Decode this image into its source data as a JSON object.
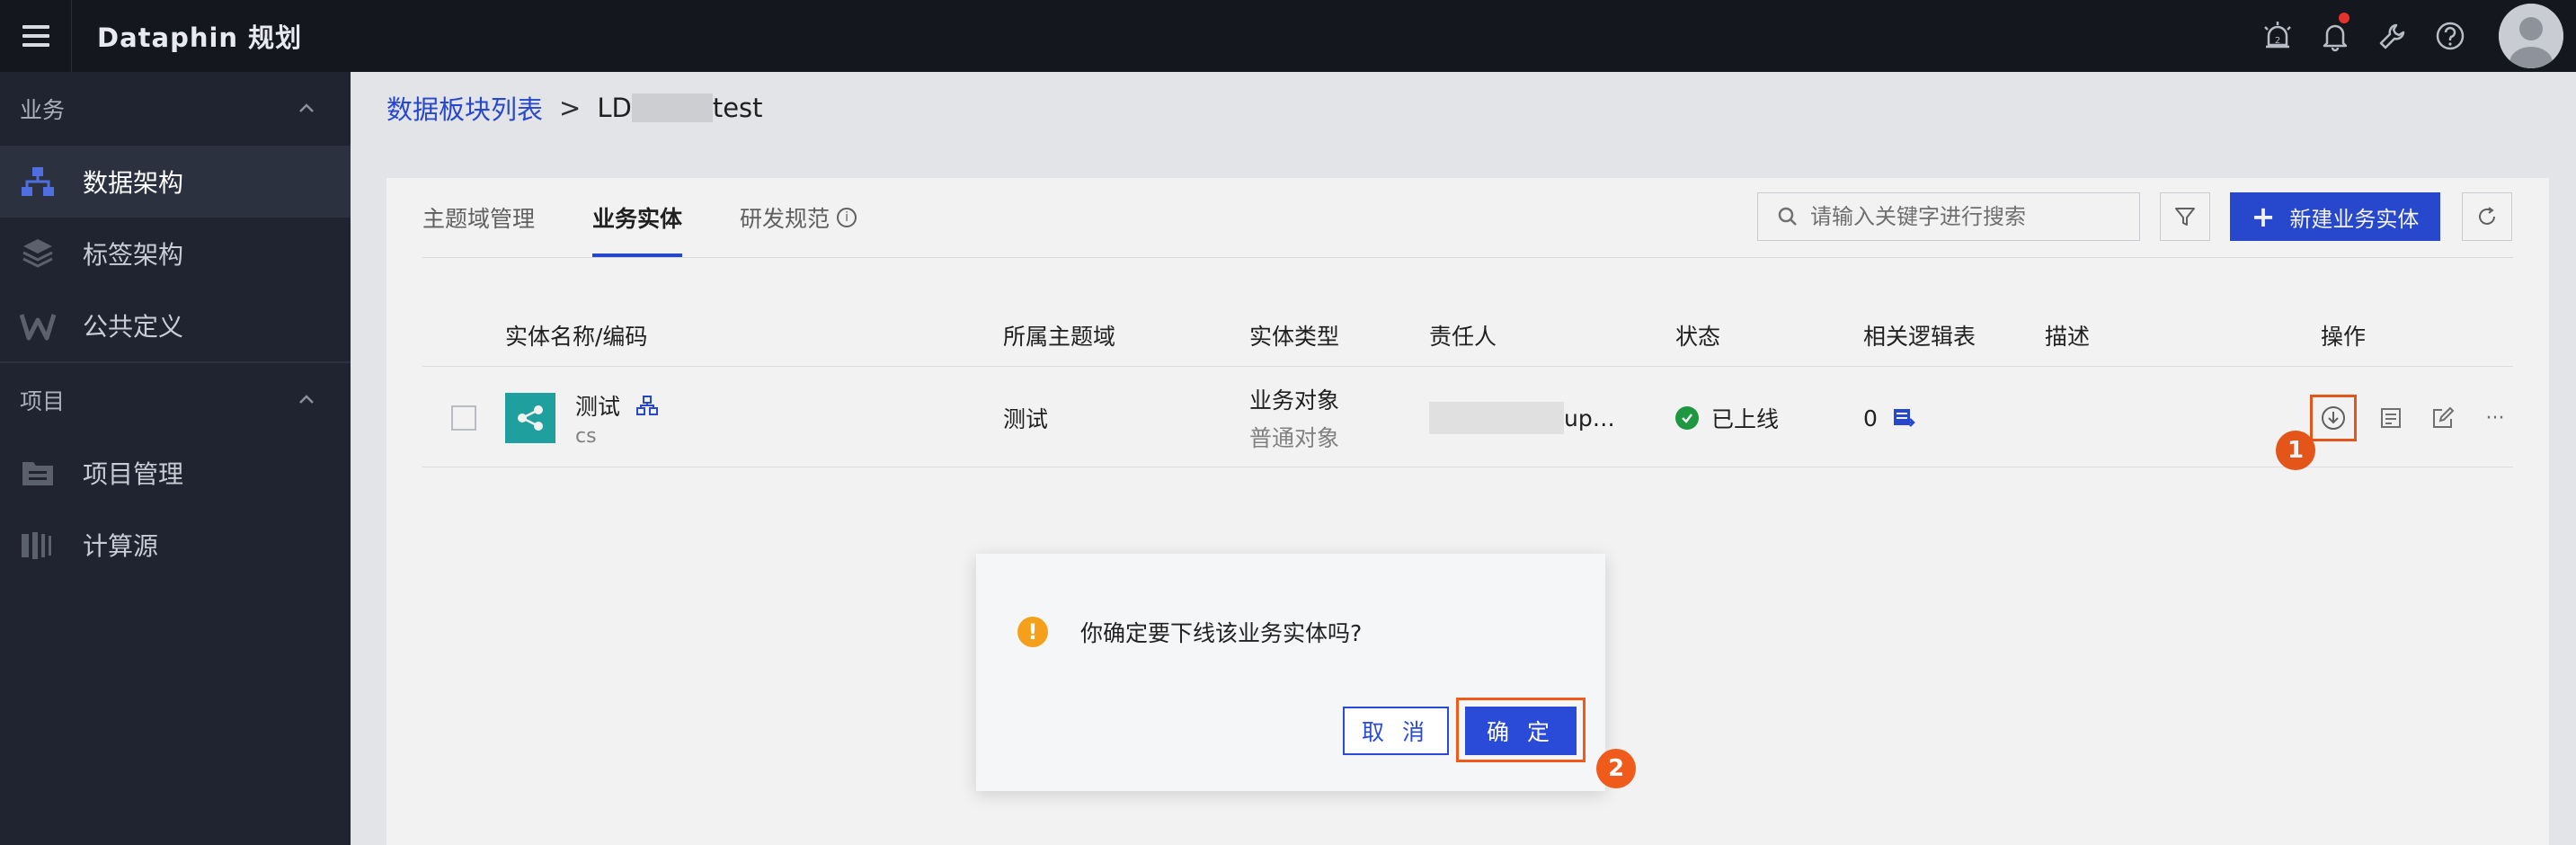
{
  "app": {
    "title": "Dataphin 规划"
  },
  "topbar": {
    "icons": [
      "alarm-icon",
      "bell-icon",
      "wrench-icon",
      "help-icon",
      "avatar"
    ],
    "has_notification": true
  },
  "sidebar": {
    "groups": [
      {
        "label": "业务",
        "items": [
          {
            "label": "数据架构",
            "icon": "hierarchy-icon",
            "active": true
          },
          {
            "label": "标签架构",
            "icon": "layers-icon",
            "active": false
          },
          {
            "label": "公共定义",
            "icon": "w-icon",
            "active": false
          }
        ]
      },
      {
        "label": "项目",
        "items": [
          {
            "label": "项目管理",
            "icon": "folder-icon",
            "active": false
          },
          {
            "label": "计算源",
            "icon": "compute-icon",
            "active": false
          }
        ]
      }
    ]
  },
  "breadcrumb": {
    "parent": "数据板块列表",
    "separator": ">",
    "current_prefix": "LD",
    "current_suffix": "test"
  },
  "tabs": [
    {
      "label": "主题域管理",
      "active": false
    },
    {
      "label": "业务实体",
      "active": true
    },
    {
      "label": "研发规范",
      "active": false,
      "info": "i"
    }
  ],
  "toolbar": {
    "search_placeholder": "请输入关键字进行搜索",
    "new_button": "新建业务实体",
    "new_plus": "+"
  },
  "table": {
    "columns": [
      "实体名称/编码",
      "所属主题域",
      "实体类型",
      "责任人",
      "状态",
      "相关逻辑表",
      "描述",
      "操作"
    ],
    "rows": [
      {
        "name": "测试",
        "code": "cs",
        "subject": "测试",
        "type": "业务对象",
        "subtype": "普通对象",
        "owner_suffix": "up…",
        "status": "已上线",
        "logic_tables": "0",
        "description": "",
        "more": "···"
      }
    ]
  },
  "steps": {
    "first": "1",
    "second": "2"
  },
  "dialog": {
    "warn_glyph": "!",
    "message": "你确定要下线该业务实体吗?",
    "cancel": "取 消",
    "confirm": "确 定"
  },
  "colors": {
    "primary": "#2a4bd8",
    "highlight": "#f05a1a",
    "online": "#21a045",
    "warning": "#f5a01a"
  }
}
